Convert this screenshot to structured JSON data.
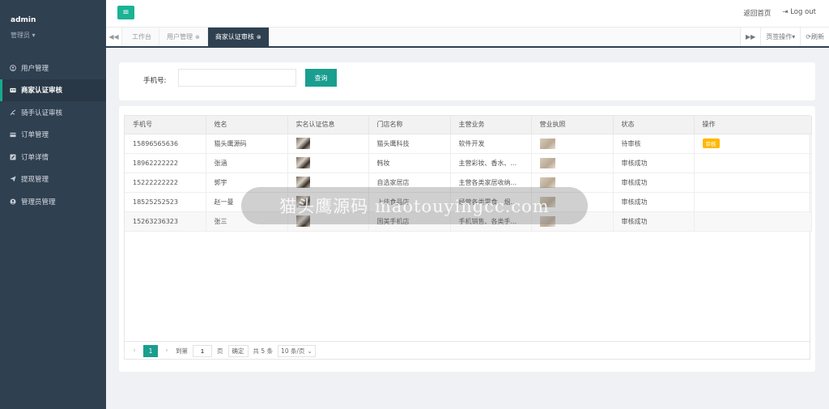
{
  "sidebar": {
    "user": "admin",
    "role": "管理员 ▾",
    "items": [
      {
        "label": "用户管理",
        "icon": "user-circle-icon"
      },
      {
        "label": "商家认证审核",
        "icon": "id-card-icon",
        "active": true
      },
      {
        "label": "骑手认证审核",
        "icon": "bike-icon"
      },
      {
        "label": "订单管理",
        "icon": "credit-card-icon"
      },
      {
        "label": "订单详情",
        "icon": "edit-icon"
      },
      {
        "label": "提现管理",
        "icon": "send-icon"
      },
      {
        "label": "管理员管理",
        "icon": "user-icon"
      }
    ]
  },
  "topbar": {
    "menu_toggle": "≡",
    "home_link": "返回首页",
    "logout": "Log out"
  },
  "tabs": {
    "items": [
      "工作台",
      "用户管理",
      "商家认证审核"
    ],
    "page_ops": "页签操作",
    "refresh": "刷新"
  },
  "search": {
    "label": "手机号:",
    "placeholder": "",
    "button": "查询"
  },
  "table": {
    "headers": [
      "手机号",
      "姓名",
      "实名认证信息",
      "门店名称",
      "主营业务",
      "营业执照",
      "状态",
      "操作"
    ],
    "rows": [
      {
        "phone": "15896565636",
        "name": "猫头鹰源码",
        "store": "猫头鹰科技",
        "business": "软件开发",
        "status": "待审核",
        "action": "审核"
      },
      {
        "phone": "18962222222",
        "name": "张涵",
        "store": "韩妆",
        "business": "主营彩妆、香水、...",
        "status": "审核成功",
        "action": ""
      },
      {
        "phone": "15222222222",
        "name": "郭宇",
        "store": "自选家居店",
        "business": "主营各类家居收纳...",
        "status": "审核成功",
        "action": ""
      },
      {
        "phone": "18525252523",
        "name": "赵一曼",
        "store": "上佳食品店",
        "business": "经营各类零食、烟...",
        "status": "审核成功",
        "action": ""
      },
      {
        "phone": "15263236323",
        "name": "张三",
        "store": "国美手机店",
        "business": "手机销售、各类手...",
        "status": "审核成功",
        "action": ""
      }
    ]
  },
  "pager": {
    "current": "1",
    "goto": "到第",
    "goto_value": "1",
    "page_unit": "页",
    "confirm": "确定",
    "total": "共 5 条",
    "size": "10 条/页"
  },
  "watermark": "猫头鹰源码 maotouyingcc.com"
}
